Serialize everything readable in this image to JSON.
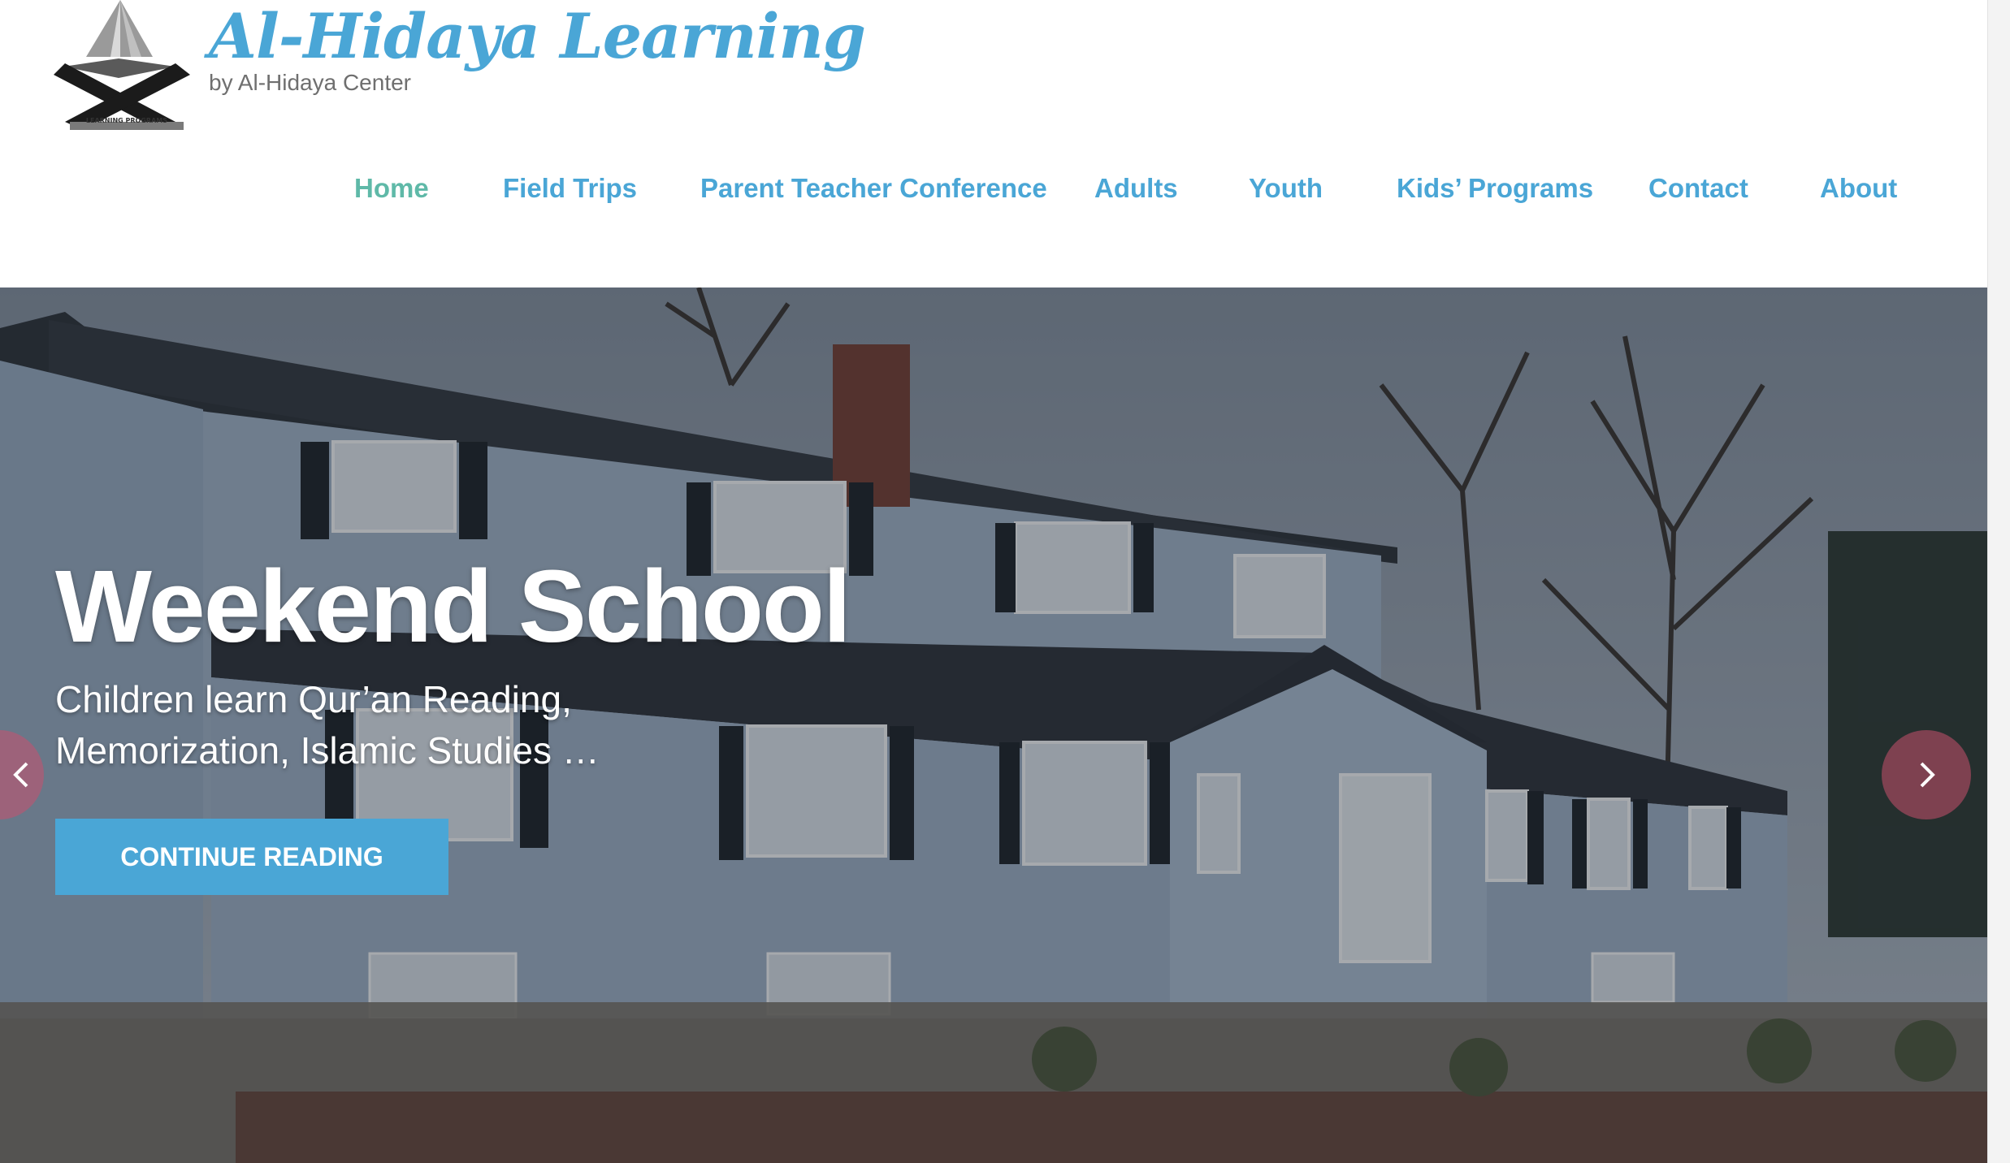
{
  "site": {
    "title": "Al-Hidaya Learning",
    "tagline": "by Al-Hidaya Center",
    "logo_icon": "book-logo-icon",
    "logo_text": "LEARNING PROGRAMS"
  },
  "nav": {
    "items": [
      {
        "label": "Home",
        "active": true
      },
      {
        "label": "Field Trips"
      },
      {
        "label": "Parent Teacher Conference"
      },
      {
        "label": "Adults"
      },
      {
        "label": "Youth"
      },
      {
        "label": "Kids’ Programs"
      },
      {
        "label": "Contact"
      },
      {
        "label": "About"
      }
    ]
  },
  "hero": {
    "title": "Weekend School",
    "subtitle_line1": "Children learn Qur’an Reading,",
    "subtitle_line2": "Memorization, Islamic Studies …",
    "cta_label": "CONTINUE READING",
    "prev_icon": "chevron-left-icon",
    "next_icon": "chevron-right-icon"
  },
  "colors": {
    "brand": "#4aa6d6",
    "nav_active": "#5fb9a8",
    "arrow": "#c8506e"
  }
}
